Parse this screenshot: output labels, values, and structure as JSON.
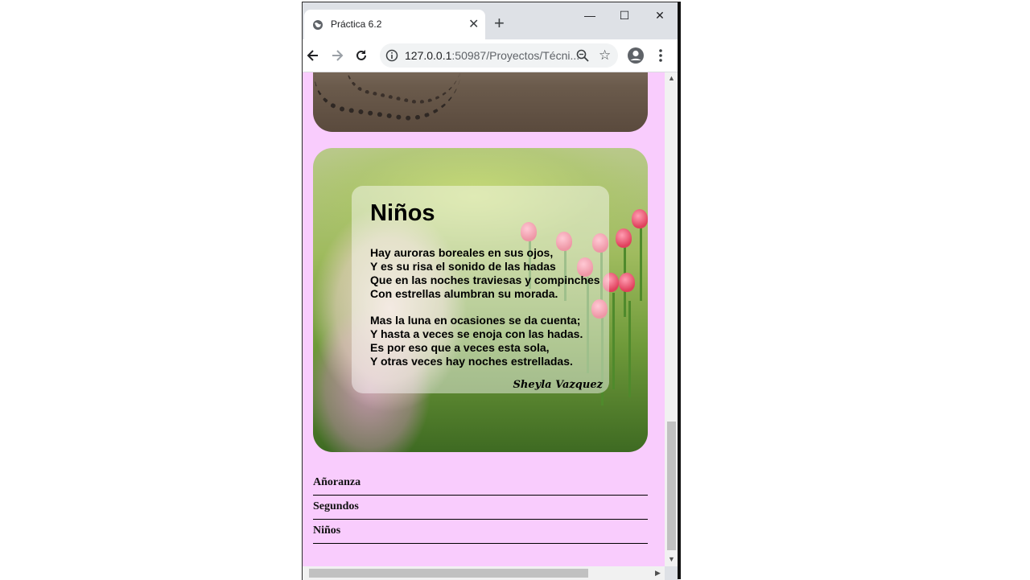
{
  "browser": {
    "tab_title": "Práctica 6.2",
    "tab_close": "✕",
    "new_tab": "+",
    "url_host": "127.0.0.1",
    "url_rest": ":50987/Proyectos/Técni...",
    "controls": {
      "minimize": "—",
      "maximize": "☐",
      "close": "✕"
    }
  },
  "poem": {
    "title": "Niños",
    "stanza1": "Hay auroras boreales en sus ojos,\nY es su risa el sonido de las hadas\nQue en las noches traviesas y compinches\nCon estrellas alumbran su morada.",
    "stanza2": "Mas la luna en ocasiones se da cuenta;\nY hasta a veces se enoja con las hadas.\nEs por eso que a veces esta sola,\nY otras veces hay noches estrelladas.",
    "author": "Sheyla Vazquez"
  },
  "nav": {
    "items": [
      {
        "label": "Añoranza"
      },
      {
        "label": "Segundos"
      },
      {
        "label": "Niños"
      }
    ]
  },
  "colors": {
    "page_bg": "#f9ccfd",
    "accent": "#e0405c"
  }
}
